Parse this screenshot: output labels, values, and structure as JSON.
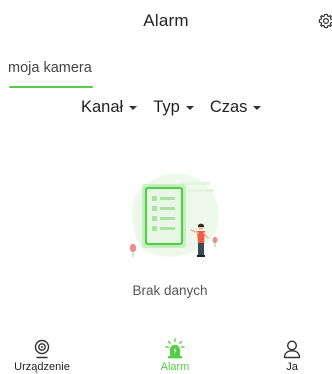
{
  "header": {
    "title": "Alarm",
    "settings_icon": "gear-icon"
  },
  "device_tab": {
    "label": "moja kamera",
    "active": true
  },
  "filters": [
    {
      "label": "Kanał"
    },
    {
      "label": "Typ"
    },
    {
      "label": "Czas"
    }
  ],
  "empty_state": {
    "illustration": "empty-list-illustration",
    "text": "Brak danych"
  },
  "tabbar": {
    "items": [
      {
        "label": "Urządzenie",
        "icon": "camera-icon",
        "active": false
      },
      {
        "label": "Alarm",
        "icon": "alarm-icon",
        "active": true
      },
      {
        "label": "Ja",
        "icon": "user-icon",
        "active": false
      }
    ]
  },
  "colors": {
    "accent": "#56cd46",
    "text": "#222222",
    "muted": "#555555"
  }
}
